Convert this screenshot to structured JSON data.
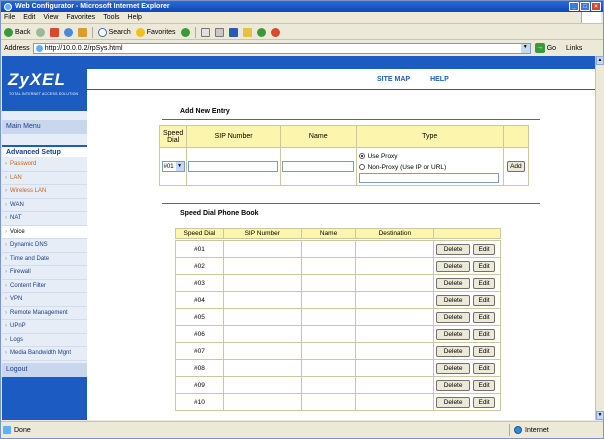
{
  "window": {
    "title": "Web Configurator - Microsoft Internet Explorer"
  },
  "menu": [
    "File",
    "Edit",
    "View",
    "Favorites",
    "Tools",
    "Help"
  ],
  "toolbar": {
    "back": "Back",
    "search": "Search",
    "favorites": "Favorites"
  },
  "address": {
    "label": "Address",
    "url": "http://10.0.0.2/rpSys.html",
    "go": "Go",
    "links": "Links"
  },
  "logo": {
    "name": "ZyXEL",
    "tagline": "TOTAL INTERNET ACCESS SOLUTION"
  },
  "header": {
    "site_map": "SITE MAP",
    "help": "HELP"
  },
  "sidebar": {
    "main_menu": "Main Menu",
    "advanced_setup": "Advanced Setup",
    "items": [
      "Password",
      "LAN",
      "Wireless LAN",
      "WAN",
      "NAT",
      "Voice",
      "Dynamic DNS",
      "Time and Date",
      "Firewall",
      "Content Filter",
      "VPN",
      "Remote Management",
      "UPnP",
      "Logs",
      "Media Bandwidth Mgnt"
    ],
    "active_item": "Voice",
    "logout": "Logout"
  },
  "add_entry": {
    "title": "Add New Entry",
    "col_speed_dial": "Speed Dial",
    "col_sip": "SIP Number",
    "col_name": "Name",
    "col_type": "Type",
    "speed_dial_value": "#01",
    "opt_proxy": "Use Proxy",
    "opt_non_proxy": "Non-Proxy (Use IP or URL)",
    "add_button": "Add"
  },
  "phone_book": {
    "title": "Speed Dial Phone Book",
    "columns": [
      "Speed Dial",
      "SIP Number",
      "Name",
      "Destination"
    ],
    "rows": [
      "#01",
      "#02",
      "#03",
      "#04",
      "#05",
      "#06",
      "#07",
      "#08",
      "#09",
      "#10"
    ],
    "delete_label": "Delete",
    "edit_label": "Edit"
  },
  "status": {
    "left": "Done",
    "zone": "Internet"
  },
  "colors": {
    "brand_blue": "#1c5bc2",
    "header_yellow": "#fbf5ad",
    "accent_orange": "#c86418"
  }
}
